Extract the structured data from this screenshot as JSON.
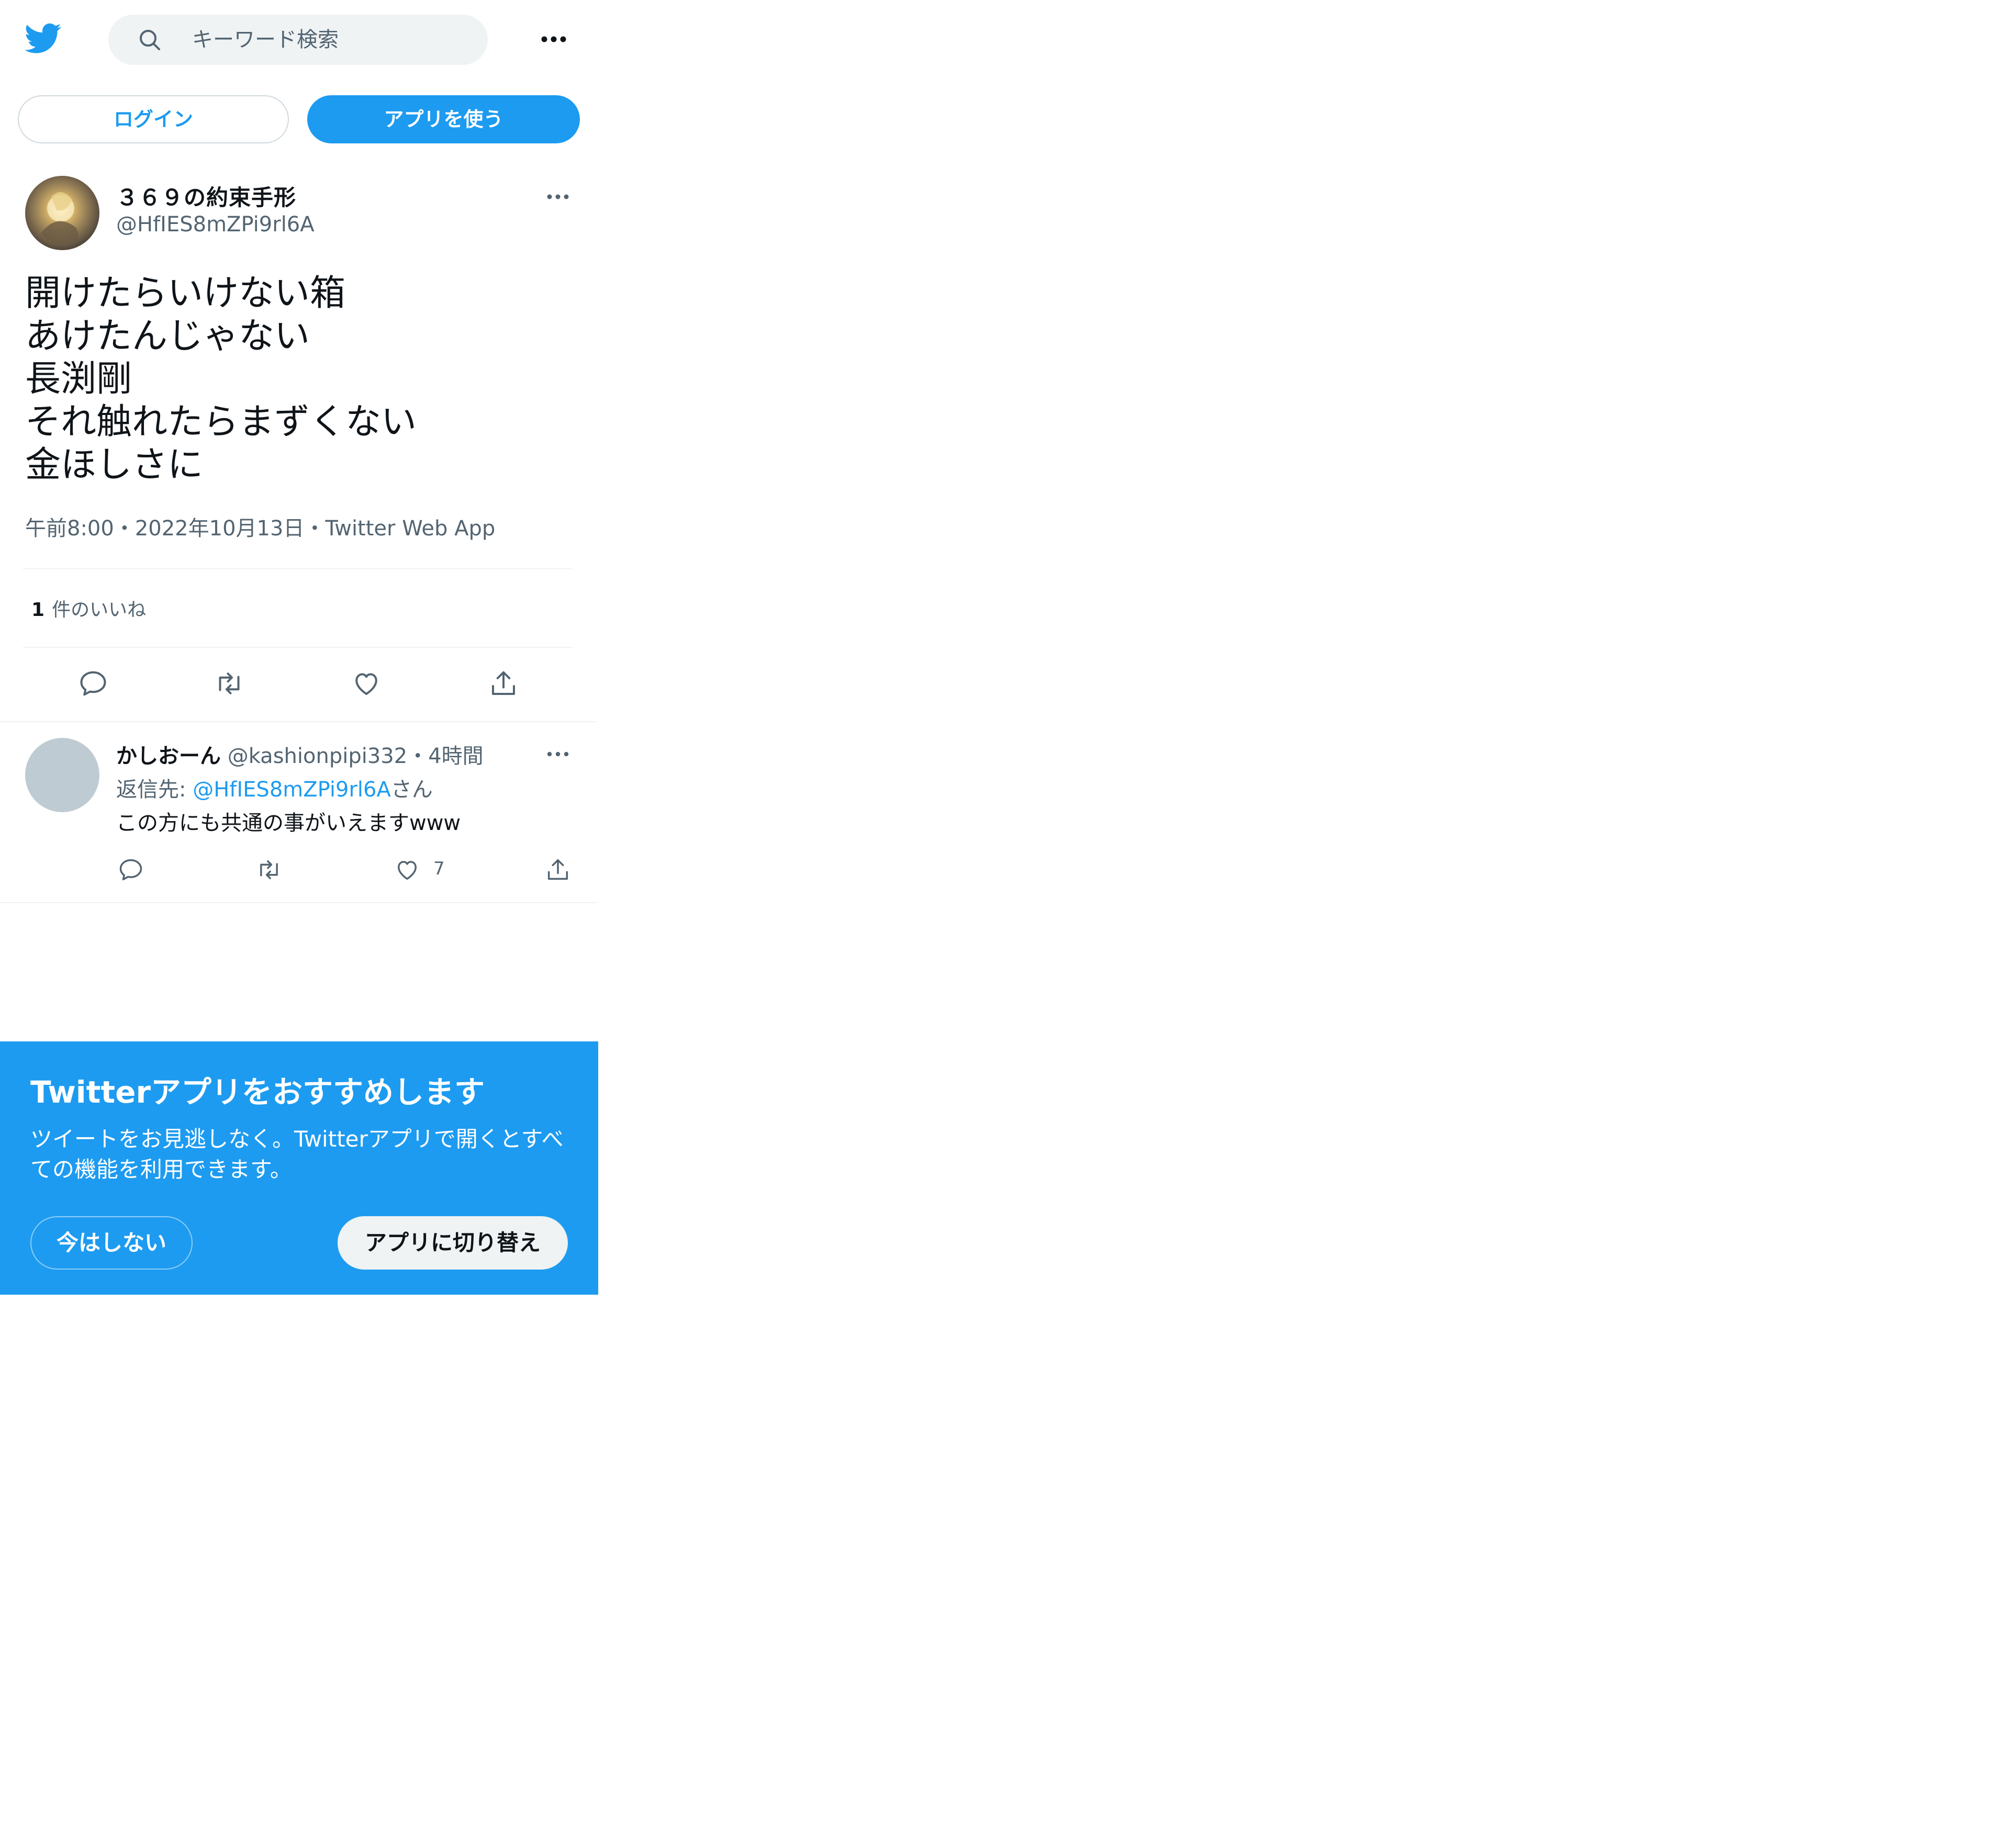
{
  "header": {
    "logo_icon": "twitter-bird-icon",
    "search_placeholder": "キーワード検索",
    "search_icon": "search-icon",
    "more_icon": "more-horizontal-icon"
  },
  "auth": {
    "login_label": "ログイン",
    "use_app_label": "アプリを使う"
  },
  "tweet": {
    "display_name": "３６９の約束手形",
    "handle": "@HfIES8mZPi9rl6A",
    "text_lines": [
      "開けたらいけない箱",
      "あけたんじゃない",
      "長渕剛",
      "それ触れたらまずくない",
      "金ほしさに"
    ],
    "meta": "午前8:00・2022年10月13日・Twitter Web App",
    "likes_count": "1",
    "likes_label": "件のいいね",
    "actions": [
      "reply-icon",
      "retweet-icon",
      "like-icon",
      "share-icon"
    ]
  },
  "reply": {
    "display_name": "かしおーん",
    "handle": "@kashionpipi332",
    "separator": "・",
    "time": "4時間",
    "reply_to_prefix": "返信先: ",
    "reply_to_mention": "@HfIES8mZPi9rl6A",
    "reply_to_suffix": "さん",
    "text": "この方にも共通の事がいえますwww",
    "like_count": "7"
  },
  "banner": {
    "title": "Twitterアプリをおすすめします",
    "description": "ツイートをお見逃しなく。Twitterアプリで開くとすべての機能を利用できます。",
    "not_now_label": "今はしない",
    "switch_label": "アプリに切り替え"
  },
  "colors": {
    "accent": "#1d9bf0",
    "text": "#0f1419",
    "secondary": "#536471",
    "search_bg": "#eff3f4"
  }
}
